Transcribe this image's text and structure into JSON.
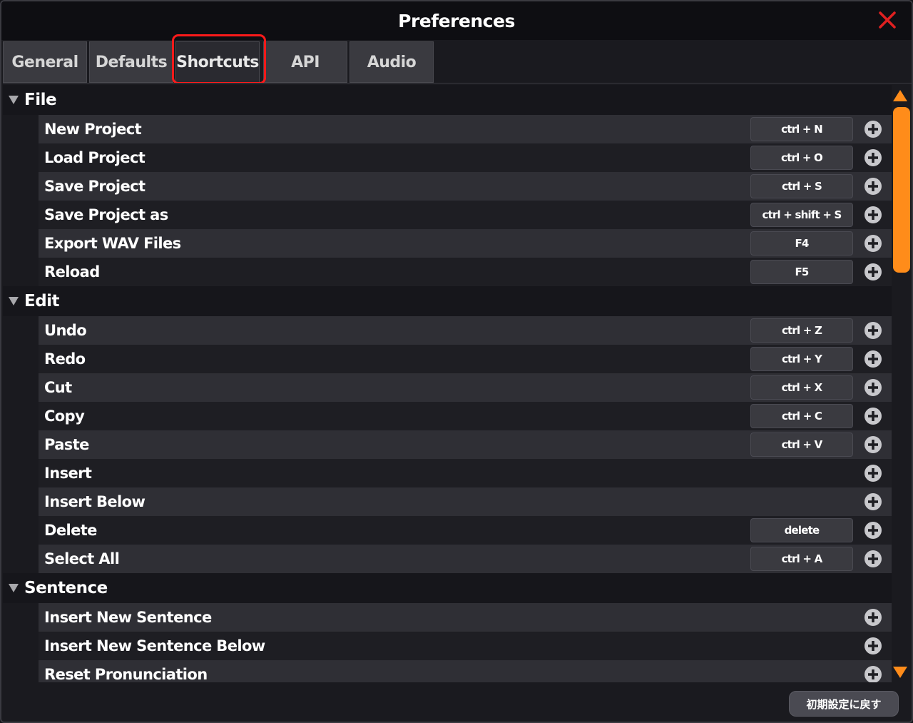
{
  "window": {
    "title": "Preferences"
  },
  "tabs": [
    {
      "label": "General"
    },
    {
      "label": "Defaults"
    },
    {
      "label": "Shortcuts"
    },
    {
      "label": "API"
    },
    {
      "label": "Audio"
    }
  ],
  "active_tab": "Shortcuts",
  "sections": {
    "file": {
      "label": "File",
      "items": [
        {
          "name": "New Project",
          "key": "ctrl + N"
        },
        {
          "name": "Load Project",
          "key": "ctrl + O"
        },
        {
          "name": "Save Project",
          "key": "ctrl + S"
        },
        {
          "name": "Save Project as",
          "key": "ctrl + shift + S"
        },
        {
          "name": "Export WAV Files",
          "key": "F4"
        },
        {
          "name": "Reload",
          "key": "F5"
        }
      ]
    },
    "edit": {
      "label": "Edit",
      "items": [
        {
          "name": "Undo",
          "key": "ctrl + Z"
        },
        {
          "name": "Redo",
          "key": "ctrl + Y"
        },
        {
          "name": "Cut",
          "key": "ctrl + X"
        },
        {
          "name": "Copy",
          "key": "ctrl + C"
        },
        {
          "name": "Paste",
          "key": "ctrl + V"
        },
        {
          "name": "Insert",
          "key": ""
        },
        {
          "name": "Insert Below",
          "key": ""
        },
        {
          "name": "Delete",
          "key": "delete"
        },
        {
          "name": "Select All",
          "key": "ctrl + A"
        }
      ]
    },
    "sentence": {
      "label": "Sentence",
      "items": [
        {
          "name": "Insert New Sentence",
          "key": ""
        },
        {
          "name": "Insert New Sentence Below",
          "key": ""
        },
        {
          "name": "Reset Pronunciation",
          "key": ""
        }
      ]
    }
  },
  "footer": {
    "reset_label": "初期設定に戻す"
  },
  "colors": {
    "accent": "#ff8c1a",
    "close": "#e02020",
    "highlight": "#ff1a1a"
  },
  "icons": {
    "close": "close-icon",
    "add": "plus-circle-icon",
    "collapse": "triangle-down-icon"
  }
}
